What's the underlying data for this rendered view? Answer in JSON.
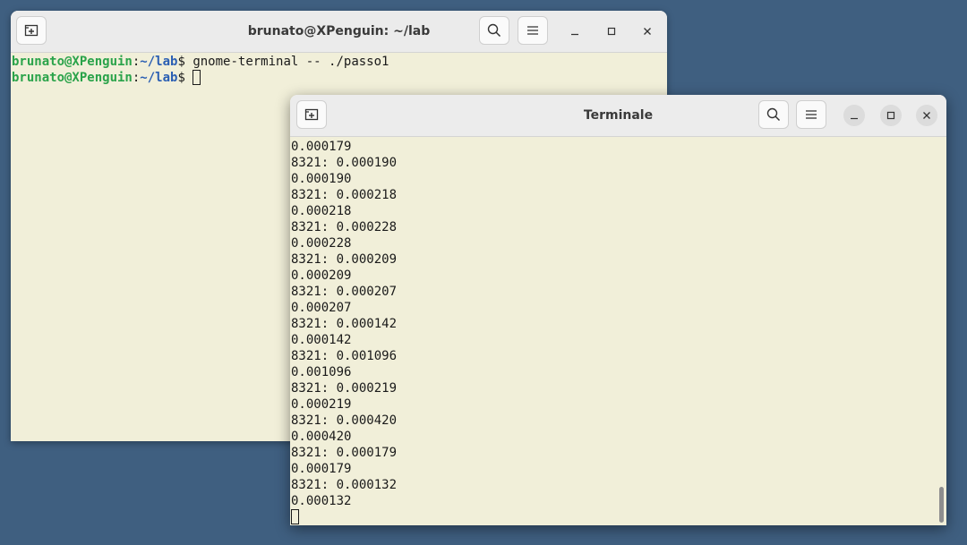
{
  "window_back": {
    "title": "brunato@XPenguin: ~/lab",
    "lines": [
      {
        "user": "brunato@XPenguin",
        "sep": ":",
        "path": "~/lab",
        "dollar": "$ ",
        "cmd": "gnome-terminal -- ./passo1"
      },
      {
        "user": "brunato@XPenguin",
        "sep": ":",
        "path": "~/lab",
        "dollar": "$ ",
        "cmd": ""
      }
    ]
  },
  "window_front": {
    "title": "Terminale",
    "lines": [
      "0.000179",
      "8321: 0.000190",
      "0.000190",
      "8321: 0.000218",
      "0.000218",
      "8321: 0.000228",
      "0.000228",
      "8321: 0.000209",
      "0.000209",
      "8321: 0.000207",
      "0.000207",
      "8321: 0.000142",
      "0.000142",
      "8321: 0.001096",
      "0.001096",
      "8321: 0.000219",
      "0.000219",
      "8321: 0.000420",
      "0.000420",
      "8321: 0.000179",
      "0.000179",
      "8321: 0.000132",
      "0.000132"
    ]
  },
  "icons": {
    "new_tab": "new-tab-icon",
    "search": "search-icon",
    "menu": "hamburger-menu-icon",
    "minimize": "minimize-icon",
    "maximize": "maximize-icon",
    "close": "close-icon"
  },
  "colors": {
    "desktop": "#3f5f80",
    "terminal_bg": "#f1efd9",
    "prompt_user": "#2aa34a",
    "prompt_path": "#2b5fb3"
  }
}
